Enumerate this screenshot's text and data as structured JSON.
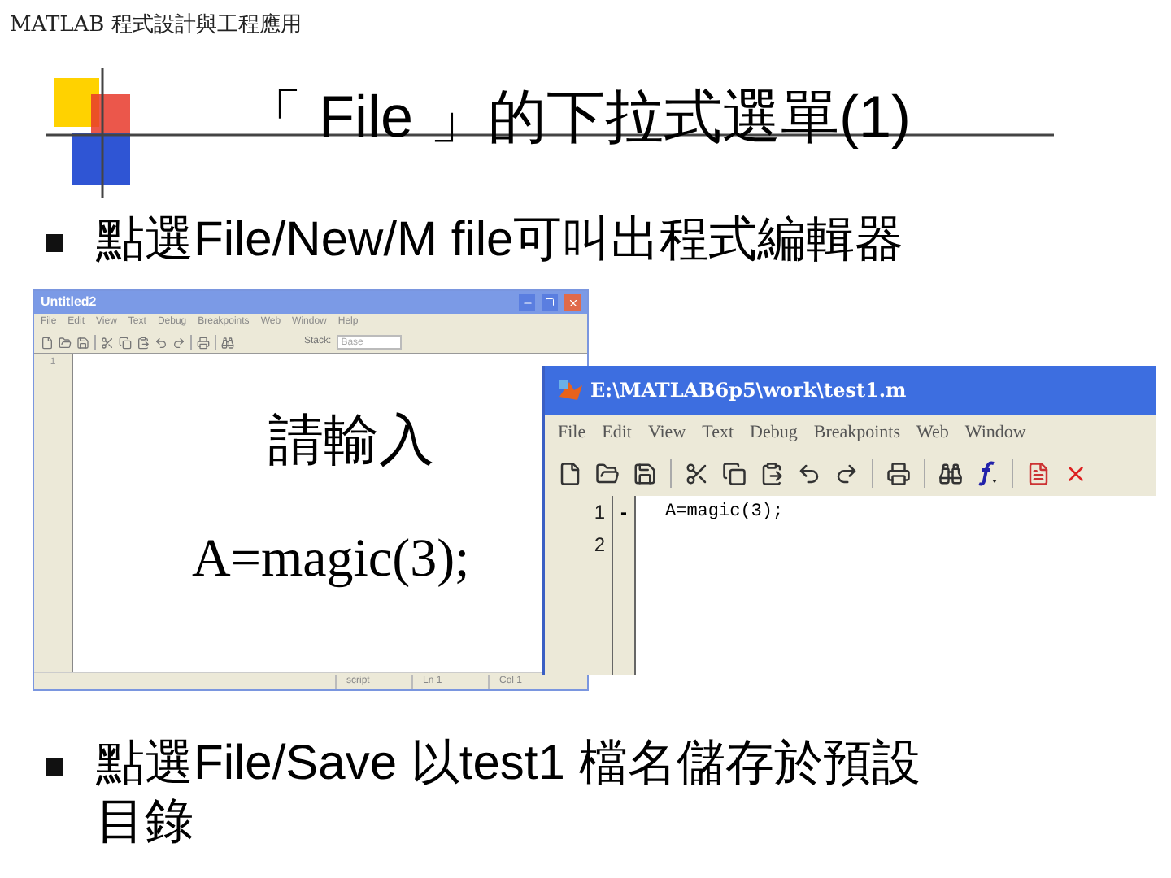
{
  "header": "MATLAB 程式設計與工程應用",
  "title": "「 File 」的下拉式選單(1)",
  "bullets": [
    {
      "text": "點選File/New/M file可叫出程式編輯器"
    },
    {
      "text": "點選File/Save 以test1 檔名儲存於預設目錄"
    }
  ],
  "back_window": {
    "title": "Untitled2",
    "menu": [
      "File",
      "Edit",
      "View",
      "Text",
      "Debug",
      "Breakpoints",
      "Web",
      "Window",
      "Help"
    ],
    "stack_label": "Stack:",
    "stack_value": "Base",
    "line_numbers": [
      "1"
    ],
    "status": [
      "script",
      "Ln 1",
      "Col 1"
    ]
  },
  "overlay_texts": {
    "prompt": "請輸入",
    "code": "A=magic(3);"
  },
  "front_window": {
    "title": "E:\\MATLAB6p5\\work\\test1.m",
    "menu": [
      "File",
      "Edit",
      "View",
      "Text",
      "Debug",
      "Breakpoints",
      "Web",
      "Window"
    ],
    "lines": [
      {
        "number": "1",
        "marker": "-",
        "code": "A=magic(3);"
      },
      {
        "number": "2"
      }
    ]
  }
}
